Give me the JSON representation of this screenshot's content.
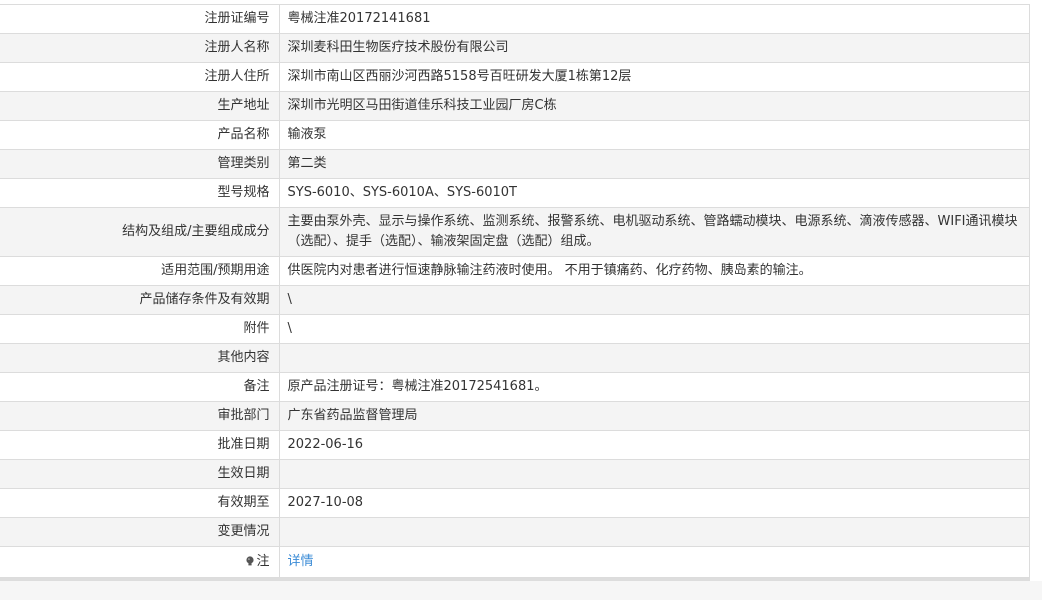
{
  "rows": [
    {
      "label": "注册证编号",
      "value": "粤械注准20172141681"
    },
    {
      "label": "注册人名称",
      "value": "深圳麦科田生物医疗技术股份有限公司"
    },
    {
      "label": "注册人住所",
      "value": "深圳市南山区西丽沙河西路5158号百旺研发大厦1栋第12层"
    },
    {
      "label": "生产地址",
      "value": "深圳市光明区马田街道佳乐科技工业园厂房C栋"
    },
    {
      "label": "产品名称",
      "value": "输液泵"
    },
    {
      "label": "管理类别",
      "value": "第二类"
    },
    {
      "label": "型号规格",
      "value": "SYS-6010、SYS-6010A、SYS-6010T"
    },
    {
      "label": "结构及组成/主要组成成分",
      "value": "主要由泵外壳、显示与操作系统、监测系统、报警系统、电机驱动系统、管路蠕动模块、电源系统、滴液传感器、WIFI通讯模块（选配）、提手（选配）、输液架固定盘（选配）组成。"
    },
    {
      "label": "适用范围/预期用途",
      "value": "供医院内对患者进行恒速静脉输注药液时使用。 不用于镇痛药、化疗药物、胰岛素的输注。"
    },
    {
      "label": "产品储存条件及有效期",
      "value": "\\"
    },
    {
      "label": "附件",
      "value": "\\"
    },
    {
      "label": "其他内容",
      "value": ""
    },
    {
      "label": "备注",
      "value": "原产品注册证号：粤械注准20172541681。"
    },
    {
      "label": "审批部门",
      "value": "广东省药品监督管理局"
    },
    {
      "label": "批准日期",
      "value": "2022-06-16"
    },
    {
      "label": "生效日期",
      "value": ""
    },
    {
      "label": "有效期至",
      "value": "2027-10-08"
    },
    {
      "label": "变更情况",
      "value": ""
    }
  ],
  "note_row": {
    "label": "注",
    "link_text": "详情",
    "icon": "note-bulb-icon"
  },
  "colors": {
    "link": "#3a8bd6",
    "stripe": "#f4f4f4",
    "border": "#dcdcdc"
  }
}
